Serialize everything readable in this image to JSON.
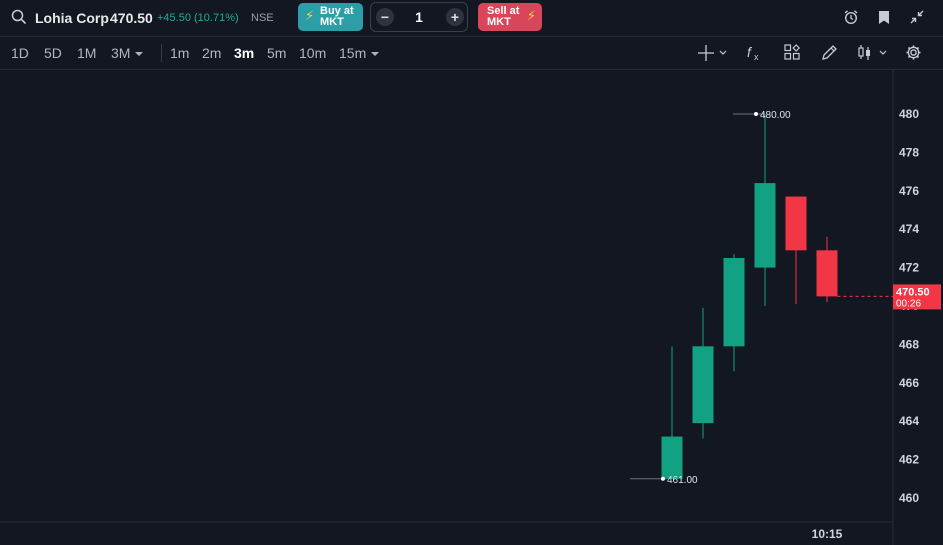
{
  "header": {
    "search_icon": "search-icon",
    "symbol": "Lohia Corp",
    "price": "470.50",
    "change": "+45.50 (10.71%)",
    "exchange": "NSE",
    "buy_label_1": "Buy at",
    "buy_label_2": "MKT",
    "sell_label_1": "Sell at",
    "sell_label_2": "MKT",
    "quantity": "1",
    "colors": {
      "change": "#22ab94",
      "buy": "#2a9fa8",
      "sell": "#d9465a"
    }
  },
  "range_buttons": [
    "1D",
    "5D",
    "1M",
    "3M"
  ],
  "interval_buttons": [
    "1m",
    "2m",
    "3m",
    "5m",
    "10m",
    "15m"
  ],
  "active_interval": "3m",
  "toolbar_icons": [
    "crosshair-icon",
    "indicators-fx-icon",
    "templates-icon",
    "drawing-pen-icon",
    "chart-type-candles-icon",
    "settings-gear-icon"
  ],
  "top_icons": [
    "alarm-clock-icon",
    "bookmark-icon",
    "collapse-icon"
  ],
  "chart_data": {
    "type": "candlestick",
    "colors": {
      "up": "#12a283",
      "down": "#f23645",
      "axis_text": "#d1d4dc",
      "background": "#131722"
    },
    "y_ticks": [
      "480",
      "478",
      "476",
      "474",
      "472",
      "470",
      "468",
      "466",
      "464",
      "462",
      "460"
    ],
    "ylim": [
      459,
      481
    ],
    "x_label": "10:15",
    "candles": [
      {
        "open": 461.0,
        "high": 467.9,
        "low": 461.0,
        "close": 463.2
      },
      {
        "open": 463.9,
        "high": 469.9,
        "low": 463.1,
        "close": 467.9
      },
      {
        "open": 467.9,
        "high": 472.7,
        "low": 466.6,
        "close": 472.5
      },
      {
        "open": 472.0,
        "high": 480.0,
        "low": 470.0,
        "close": 476.4
      },
      {
        "open": 475.7,
        "high": 475.7,
        "low": 470.1,
        "close": 472.9
      },
      {
        "open": 472.9,
        "high": 473.6,
        "low": 470.2,
        "close": 470.5
      }
    ],
    "high_marker": "480.00",
    "low_marker": "461.00",
    "last_price_label": "470.50",
    "countdown_label": "00:26",
    "last_price": 470.5
  }
}
